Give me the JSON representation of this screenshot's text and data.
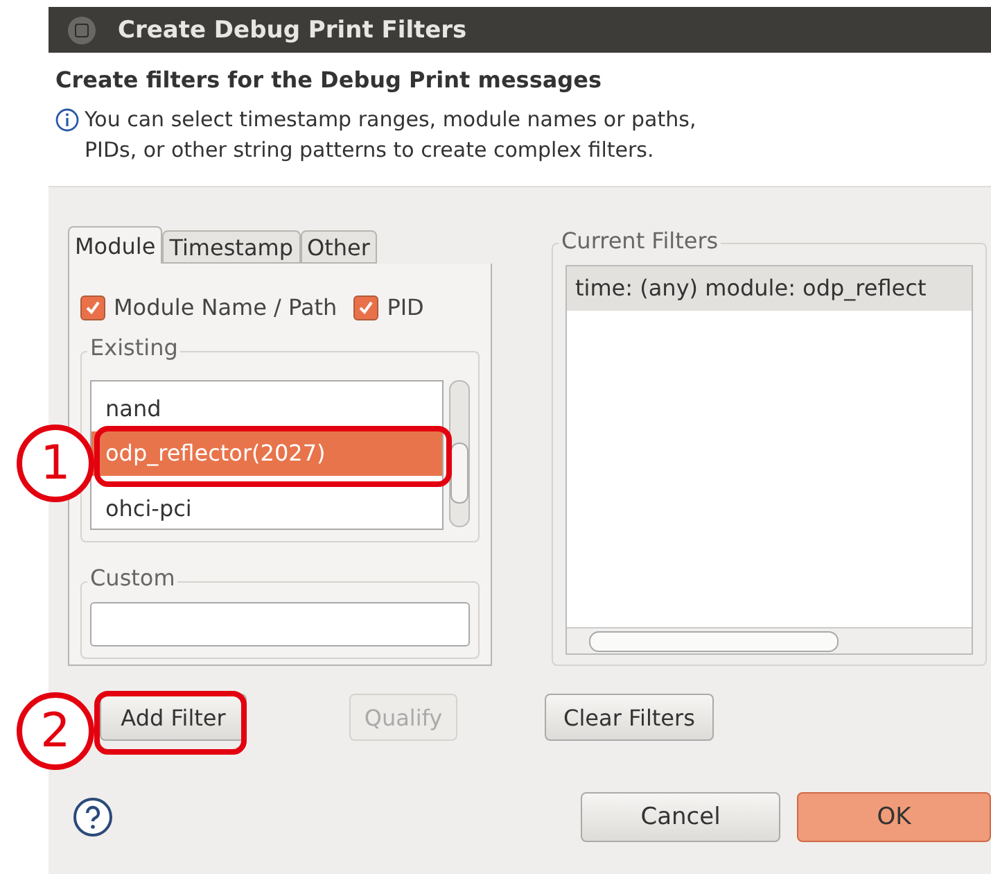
{
  "window": {
    "title": "Create Debug Print Filters"
  },
  "header": {
    "title": "Create filters for the Debug Print messages",
    "info_lines": [
      "You can select timestamp ranges, module names or paths,",
      "PIDs, or other string patterns to create complex filters."
    ]
  },
  "tabs": [
    {
      "label": "Module",
      "selected": true
    },
    {
      "label": "Timestamp",
      "selected": false
    },
    {
      "label": "Other",
      "selected": false
    }
  ],
  "options": [
    {
      "label": "Module Name / Path",
      "checked": true
    },
    {
      "label": "PID",
      "checked": true
    }
  ],
  "existing": {
    "title": "Existing",
    "items": [
      {
        "label": "nand",
        "selected": false
      },
      {
        "label": "odp_reflector(2027)",
        "selected": true
      },
      {
        "label": "ohci-pci",
        "selected": false
      }
    ]
  },
  "custom": {
    "title": "Custom"
  },
  "current_filters": {
    "title": "Current Filters",
    "items": [
      {
        "label": "time: (any) module: odp_reflect",
        "selected": true
      }
    ]
  },
  "buttons": [
    {
      "label": "Add Filter",
      "disabled": false
    },
    {
      "label": "Qualify",
      "disabled": true
    },
    {
      "label": "Clear Filters",
      "disabled": false
    }
  ],
  "footer_buttons": [
    {
      "label": "Cancel",
      "default": false
    },
    {
      "label": "OK",
      "default": true
    }
  ],
  "callouts": [
    {
      "label": "1"
    },
    {
      "label": "2"
    }
  ]
}
